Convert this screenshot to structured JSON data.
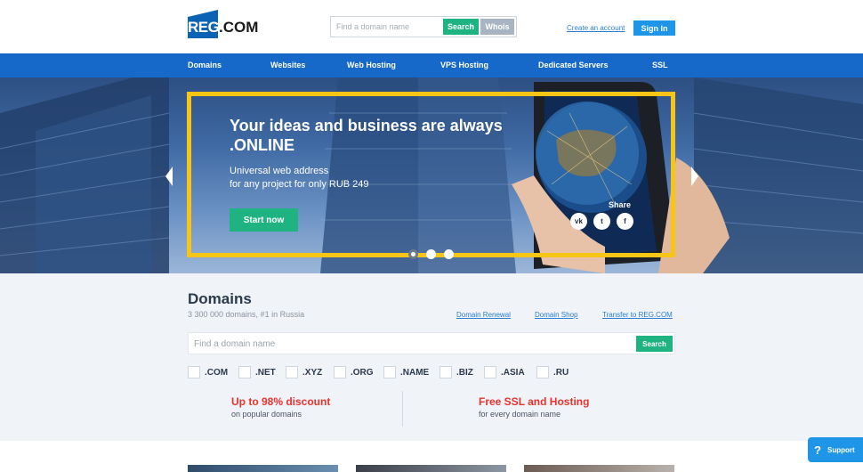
{
  "header": {
    "logo_mark": "REG",
    "logo_rest": ".COM",
    "search_placeholder": "Find a domain name",
    "search_label": "Search",
    "whois_label": "Whois",
    "create_account": "Create an account",
    "sign_in": "Sign In"
  },
  "nav": {
    "items": [
      "Domains",
      "Websites",
      "Web Hosting",
      "VPS Hosting",
      "Dedicated Servers",
      "SSL"
    ]
  },
  "hero": {
    "title": "Your ideas and business are always .ONLINE",
    "subtitle_line1": "Universal web address",
    "subtitle_line2": "for any project for only RUB 249",
    "cta": "Start now",
    "share": "Share",
    "share_icons": [
      "vk-icon",
      "twitter-icon",
      "facebook-icon"
    ],
    "share_glyphs": [
      "vk",
      "t",
      "f"
    ],
    "slides_total": 3,
    "slide_active": 1,
    "frame_color": "#f6c516"
  },
  "domains": {
    "title": "Domains",
    "subtitle": "3 300 000 domains, #1 in Russia",
    "links": [
      "Domain Renewal",
      "Domain Shop",
      "Transfer to REG.COM"
    ],
    "search_placeholder": "Find a domain name",
    "search_label": "Search",
    "tlds": [
      ".COM",
      ".NET",
      ".XYZ",
      ".ORG",
      ".NAME",
      ".BIZ",
      ".ASIA",
      ".RU"
    ],
    "promos": [
      {
        "title": "Up to 98% discount",
        "subtitle": "on popular domains"
      },
      {
        "title": "Free SSL and Hosting",
        "subtitle": "for every domain name"
      }
    ]
  },
  "support": {
    "icon": "?",
    "label": "Support"
  },
  "colors": {
    "brand_blue": "#1769c9",
    "green": "#1fb382",
    "accent_red": "#e8332e",
    "link_blue": "#2a7fd4"
  }
}
